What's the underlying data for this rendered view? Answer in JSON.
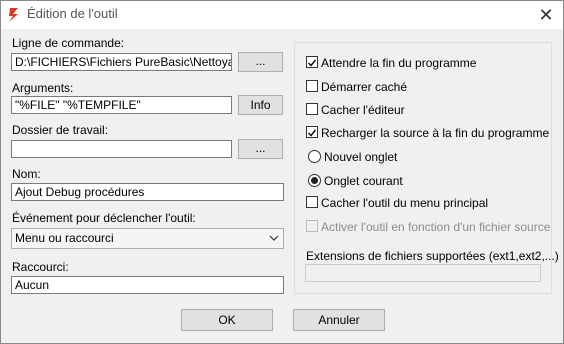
{
  "window": {
    "title": "Édition de l'outil",
    "close_glyph": "✕",
    "icon": "purebasic-flame-icon"
  },
  "left": {
    "commandline": {
      "label": "Ligne de commande:",
      "value": "D:\\FICHIERS\\Fichiers PureBasic\\NettoyageC",
      "browse": "..."
    },
    "arguments": {
      "label": "Arguments:",
      "value": "\"%FILE\" \"%TEMPFILE\"",
      "info": "Info"
    },
    "workdir": {
      "label": "Dossier de travail:",
      "value": "",
      "browse": "..."
    },
    "name": {
      "label": "Nom:",
      "value": "Ajout Debug procédures"
    },
    "trigger": {
      "label": "Événement pour déclencher l'outil:",
      "value": "Menu ou raccourci"
    },
    "shortcut": {
      "label": "Raccourci:",
      "value": "Aucun"
    }
  },
  "right": {
    "options": [
      {
        "label": "Attendre la fin du programme",
        "checked": true,
        "enabled": true
      },
      {
        "label": "Démarrer caché",
        "checked": false,
        "enabled": true
      },
      {
        "label": "Cacher l'éditeur",
        "checked": false,
        "enabled": true
      },
      {
        "label": "Recharger la source à la fin du programme",
        "checked": true,
        "enabled": true
      }
    ],
    "radios": [
      {
        "label": "Nouvel onglet",
        "selected": false
      },
      {
        "label": "Onglet courant",
        "selected": true
      }
    ],
    "options2": [
      {
        "label": "Cacher l'outil du menu principal",
        "checked": false,
        "enabled": true
      },
      {
        "label": "Activer l'outil en fonction d'un fichier source",
        "checked": false,
        "enabled": false
      }
    ],
    "extensions": {
      "label": "Extensions de fichiers supportées (ext1,ext2,...)",
      "value": ""
    }
  },
  "footer": {
    "ok": "OK",
    "cancel": "Annuler"
  }
}
